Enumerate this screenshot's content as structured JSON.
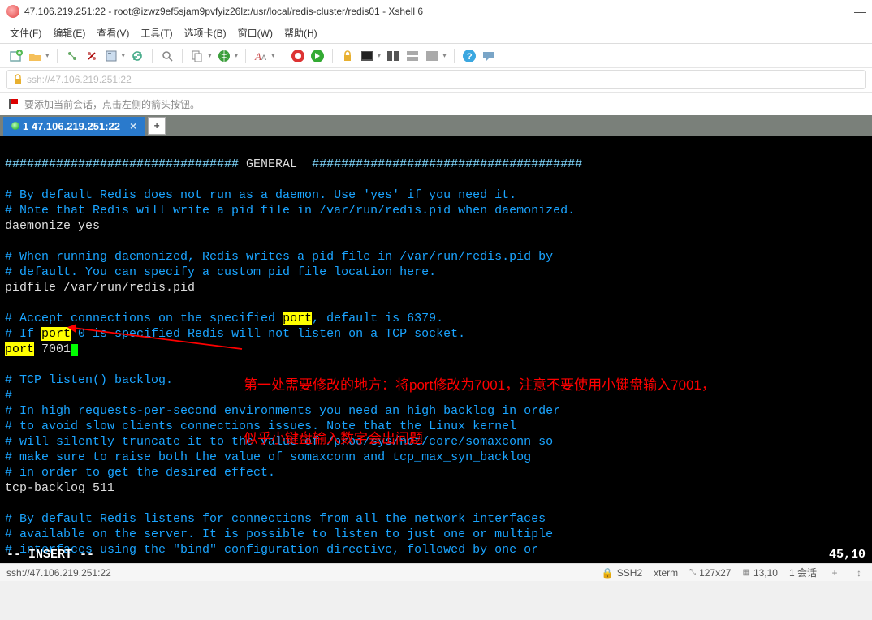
{
  "title": "47.106.219.251:22 - root@izwz9ef5sjam9pvfyiz26lz:/usr/local/redis-cluster/redis01 - Xshell 6",
  "menubar": {
    "file": "文件(F)",
    "edit": "编辑(E)",
    "view": "查看(V)",
    "tools": "工具(T)",
    "tabs": "选项卡(B)",
    "window": "窗口(W)",
    "help": "帮助(H)"
  },
  "address": "ssh://47.106.219.251:22",
  "hint": "要添加当前会话，点击左侧的箭头按钮。",
  "tab": {
    "label": "1 47.106.219.251:22"
  },
  "terminal": {
    "l1a": "################################",
    "l1b": " GENERAL  ",
    "l1c": "#####################################",
    "l3": "# By default Redis does not run as a daemon. Use 'yes' if you need it.",
    "l4": "# Note that Redis will write a pid file in /var/run/redis.pid when daemonized.",
    "l5": "daemonize yes",
    "l7": "# When running daemonized, Redis writes a pid file in /var/run/redis.pid by",
    "l8": "# default. You can specify a custom pid file location here.",
    "l9": "pidfile /var/run/redis.pid",
    "l11a": "# Accept connections on the specified ",
    "l11p": "port",
    "l11b": ", default is 6379.",
    "l12a": "# If ",
    "l12p": "port",
    "l12b": " 0 is specified Redis will not listen on a TCP socket.",
    "l13p": "port",
    "l13v": " 7001",
    "l15": "# TCP listen() backlog.",
    "l16": "#",
    "l17": "# In high requests-per-second environments you need an high backlog in order",
    "l18": "# to avoid slow clients connections issues. Note that the Linux kernel",
    "l19": "# will silently truncate it to the value of /proc/sys/net/core/somaxconn so",
    "l20": "# make sure to raise both the value of somaxconn and tcp_max_syn_backlog",
    "l21": "# in order to get the desired effect.",
    "l22": "tcp-backlog 511",
    "l24": "# By default Redis listens for connections from all the network interfaces",
    "l25": "# available on the server. It is possible to listen to just one or multiple",
    "l26": "# interfaces using the \"bind\" configuration directive, followed by one or",
    "mode": "-- INSERT --",
    "pos": "45,10"
  },
  "annotation": {
    "line1": "第一处需要修改的地方：将port修改为7001，注意不要使用小键盘输入7001，",
    "line2": "似乎小键盘输入数字会出问题"
  },
  "statusbar": {
    "addr": "ssh://47.106.219.251:22",
    "ssh": "SSH2",
    "term": "xterm",
    "size": "127x27",
    "rc": "13,10",
    "sess": "1 会话",
    "plus": "+",
    "updown": "↕"
  }
}
